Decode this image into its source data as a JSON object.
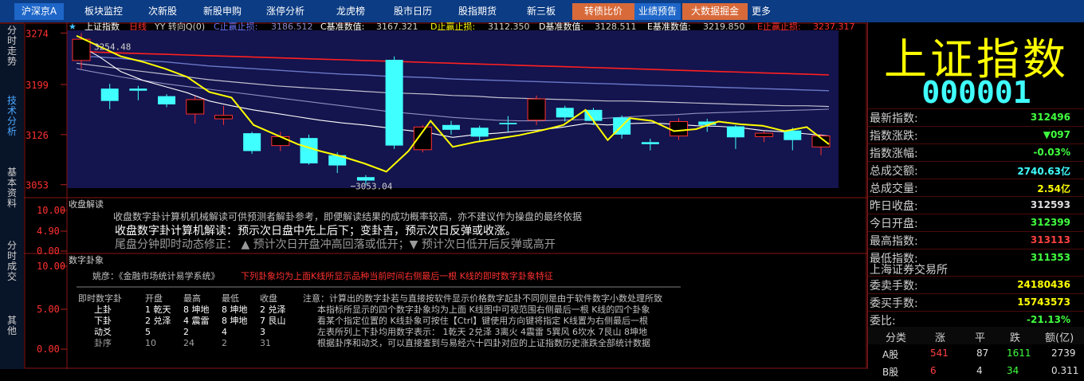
{
  "nav": {
    "tabs": [
      {
        "label": "沪深京A",
        "style": "active"
      },
      {
        "label": "板块监控",
        "style": ""
      },
      {
        "label": "次新股",
        "style": ""
      },
      {
        "label": "新股申购",
        "style": ""
      },
      {
        "label": "涨停分析",
        "style": ""
      },
      {
        "label": "龙虎榜",
        "style": ""
      },
      {
        "label": "股市日历",
        "style": ""
      },
      {
        "label": "股指期货",
        "style": ""
      },
      {
        "label": "新三板",
        "style": ""
      },
      {
        "label": "转债比价",
        "style": "orange"
      },
      {
        "label": "业绩预告",
        "style": "active"
      },
      {
        "label": "大数据掘金",
        "style": "orange"
      },
      {
        "label": "更多",
        "style": ""
      }
    ]
  },
  "sidebar": {
    "tabs": [
      {
        "label": "分时走势"
      },
      {
        "label": "技术分析"
      },
      {
        "label": "基本资料"
      },
      {
        "label": "分时成交"
      },
      {
        "label": "其他"
      }
    ]
  },
  "kline": {
    "header": {
      "name": "上证指数",
      "period": "日线",
      "mode": "YY 转向Q(0)",
      "c_stop_label": "C止赢止损:",
      "c_stop_value": "3186.512",
      "c_base_label": "C基准数值:",
      "c_base_value": "3167.321",
      "d_stop_label": "D止赢止损:",
      "d_stop_value": "3112.350",
      "d_base_label": "D基准数值:",
      "d_base_value": "3128.511",
      "e_base_label": "E基准数值:",
      "e_base_value": "3219.850",
      "e_stop_label": "E止赢止损:",
      "e_stop_value": "3237.317"
    },
    "y_labels": [
      "3274",
      "3199",
      "3126",
      "3053"
    ],
    "hi_annotation": "3254.48",
    "lo_annotation": "3053.04",
    "candles": [
      {
        "o": 3234,
        "c": 3265,
        "h": 3274,
        "l": 3222
      },
      {
        "o": 3193,
        "c": 3175,
        "h": 3200,
        "l": 3163
      },
      {
        "o": 3193,
        "c": 3190,
        "h": 3197,
        "l": 3176
      },
      {
        "o": 3182,
        "c": 3170,
        "h": 3185,
        "l": 3166
      },
      {
        "o": 3156,
        "c": 3177,
        "h": 3182,
        "l": 3142
      },
      {
        "o": 3149,
        "c": 3154,
        "h": 3168,
        "l": 3140
      },
      {
        "o": 3128,
        "c": 3102,
        "h": 3130,
        "l": 3098
      },
      {
        "o": 3110,
        "c": 3123,
        "h": 3130,
        "l": 3102
      },
      {
        "o": 3121,
        "c": 3084,
        "h": 3126,
        "l": 3082
      },
      {
        "o": 3096,
        "c": 3081,
        "h": 3100,
        "l": 3070
      },
      {
        "o": 3064,
        "c": 3059,
        "h": 3067,
        "l": 3053
      },
      {
        "o": 3235,
        "c": 3110,
        "h": 3240,
        "l": 3105
      },
      {
        "o": 3104,
        "c": 3137,
        "h": 3140,
        "l": 3100
      },
      {
        "o": 3140,
        "c": 3133,
        "h": 3146,
        "l": 3126
      },
      {
        "o": 3136,
        "c": 3123,
        "h": 3139,
        "l": 3115
      },
      {
        "o": 3143,
        "c": 3141,
        "h": 3153,
        "l": 3130
      },
      {
        "o": 3147,
        "c": 3178,
        "h": 3183,
        "l": 3140
      },
      {
        "o": 3165,
        "c": 3151,
        "h": 3168,
        "l": 3145
      },
      {
        "o": 3162,
        "c": 3146,
        "h": 3165,
        "l": 3140
      },
      {
        "o": 3151,
        "c": 3126,
        "h": 3154,
        "l": 3120
      },
      {
        "o": 3115,
        "c": 3112,
        "h": 3120,
        "l": 3103
      },
      {
        "o": 3124,
        "c": 3145,
        "h": 3150,
        "l": 3118
      },
      {
        "o": 3145,
        "c": 3140,
        "h": 3149,
        "l": 3130
      },
      {
        "o": 3138,
        "c": 3122,
        "h": 3140,
        "l": 3105
      },
      {
        "o": 3123,
        "c": 3128,
        "h": 3131,
        "l": 3115
      },
      {
        "o": 3132,
        "c": 3118,
        "h": 3136,
        "l": 3103
      },
      {
        "o": 3108,
        "c": 3124,
        "h": 3127,
        "l": 3096
      }
    ],
    "yellow_line": [
      3270,
      3255,
      3240,
      3232,
      3222,
      3210,
      3188,
      3180,
      3140,
      3126,
      3112,
      3102,
      3094,
      3084,
      3072,
      3102,
      3146,
      3108,
      3115,
      3120,
      3125,
      3132,
      3140,
      3162,
      3118,
      3150,
      3146,
      3131,
      3134,
      3145,
      3141,
      3139,
      3131,
      3137,
      3112
    ],
    "white_line": [
      3258,
      3240,
      3218,
      3205,
      3196,
      3187,
      3175,
      3168,
      3162,
      3157,
      3152,
      3147,
      3143,
      3140,
      3136,
      3132,
      3128,
      3122,
      3126,
      3128,
      3131,
      3133,
      3137,
      3142,
      3140,
      3142,
      3143,
      3141,
      3139,
      3138,
      3136,
      3132,
      3130,
      3127,
      3124
    ],
    "red_line": [
      3248,
      3246,
      3245,
      3244,
      3243,
      3242,
      3241,
      3240,
      3239,
      3238,
      3237,
      3236,
      3235,
      3234,
      3233,
      3232,
      3231,
      3230,
      3229,
      3228,
      3227,
      3226,
      3225,
      3224,
      3223,
      3222,
      3221,
      3220,
      3219,
      3218,
      3217,
      3216,
      3215,
      3214,
      3213
    ],
    "blue_line": [
      3241,
      3239,
      3237,
      3234,
      3232,
      3229,
      3226,
      3224,
      3222,
      3220,
      3218,
      3216,
      3214,
      3213,
      3211,
      3210,
      3209,
      3207,
      3206,
      3205,
      3204,
      3203,
      3202,
      3201,
      3200,
      3199,
      3198,
      3197,
      3196,
      3195,
      3194,
      3193,
      3192,
      3191,
      3190
    ],
    "gray_line": [
      3230,
      3226,
      3222,
      3218,
      3214,
      3210,
      3206,
      3203,
      3200,
      3197,
      3195,
      3193,
      3191,
      3189,
      3187,
      3186,
      3185,
      3183,
      3182,
      3180,
      3179,
      3178,
      3177,
      3176,
      3175,
      3175,
      3174,
      3173,
      3172,
      3171,
      3170,
      3169,
      3168,
      3168,
      3167
    ],
    "purple_line": [
      3222,
      3216,
      3210,
      3205,
      3200,
      3196,
      3192,
      3188,
      3184,
      3180,
      3176,
      3172,
      3168,
      3164,
      3160,
      3157,
      3154,
      3151,
      3149,
      3147,
      3146,
      3146,
      3147,
      3148,
      3150,
      3152,
      3154,
      3155,
      3157,
      3158,
      3159,
      3160,
      3161,
      3162,
      3163
    ]
  },
  "panel2": {
    "title": "收盘解读",
    "y_labels": [
      "10.00",
      "4.90",
      "0.00"
    ],
    "line1": "收盘数字卦计算机机械解读可供预测者解卦参考，即便解读结果的成功概率较高，亦不建议作为操盘的最终依据",
    "line2": "收盘数字卦计算机解读：预示次日盘中先上后下；变卦吉，预示次日反弹或收涨。",
    "line3": "尾盘分钟即时动态修正：  ▲ 预计次日开盘冲高回落或低开；▼ 预计次日低开后反弹或高开"
  },
  "panel3": {
    "title": "数字卦象",
    "y_labels": [
      "10.00",
      "5.00",
      "0.00"
    ],
    "source": "姚彦：《金融市场统计易学系统》",
    "source_red": "下列卦象均为上面K线所显示品种当前时间右侧最后一根 K线的即时数字卦象特征",
    "table_headers": [
      "即时数字卦",
      "开盘",
      "最高",
      "最低",
      "收盘"
    ],
    "table_rows": [
      [
        "上卦",
        "1 乾天",
        "8 坤地",
        "8 坤地",
        "2 兑泽"
      ],
      [
        "下卦",
        "2 兑泽",
        "4 震雷",
        "8 坤地",
        "7 艮山"
      ],
      [
        "动爻",
        "5",
        "2",
        "4",
        "3"
      ],
      [
        "卦序",
        "10",
        "24",
        "2",
        "31"
      ]
    ],
    "note_lines": [
      "注意：计算出的数字卦若与直接按软件显示价格数字起卦不同则是由于软件数字小数处理所致",
      "本指标所显示的四个数字卦象均为上面 K线图中可视范围右侧最后一根 K线的四个卦象",
      "看某个指定位置的 K线卦象可按住【Ctrl】键使用方向键将指定 K线置为右侧最后一根",
      "左表所列上下卦均用数字表示：  1乾天 2兑泽 3离火 4震雷 5巽风 6坎水 7艮山 8坤地",
      "根据卦序和动爻，可以直接查到与易经六十四卦对应的上证指数历史涨跌全部统计数据"
    ]
  },
  "quote": {
    "name": "上证指数",
    "code": "000001",
    "rows": [
      {
        "label": "最新指数:",
        "value": "312496",
        "color": "#40ff40"
      },
      {
        "label": "指数涨跌:",
        "value": "▼097",
        "color": "#40ff40"
      },
      {
        "label": "指数涨幅:",
        "value": "-0.03%",
        "color": "#40ff40"
      },
      {
        "label": "总成交额:",
        "value": "2740.63亿",
        "color": "#40ffff"
      },
      {
        "label": "总成交量:",
        "value": "2.54亿",
        "color": "#ffff00"
      },
      {
        "label": "昨日收盘:",
        "value": "312593",
        "color": "#e0e0e0"
      },
      {
        "label": "今日开盘:",
        "value": "312399",
        "color": "#40ff40"
      },
      {
        "label": "最高指数:",
        "value": "313113",
        "color": "#ff4040"
      },
      {
        "label": "最低指数:",
        "value": "311353",
        "color": "#40ff40"
      }
    ],
    "exchange": "上海证券交易所",
    "rows2": [
      {
        "label": "委卖手数:",
        "value": "24180436",
        "color": "#ffff00"
      },
      {
        "label": "委买手数:",
        "value": "15743573",
        "color": "#ffff00"
      },
      {
        "label": "委比:",
        "value": "-21.13%",
        "color": "#40ff40"
      }
    ],
    "breakdown_headers": [
      "分类",
      "涨",
      "平",
      "跌",
      "额(亿)"
    ],
    "breakdown_rows": [
      [
        "A股",
        "541",
        "87",
        "1611",
        "2739"
      ],
      [
        "B股",
        "6",
        "4",
        "34",
        "0.311"
      ]
    ]
  }
}
